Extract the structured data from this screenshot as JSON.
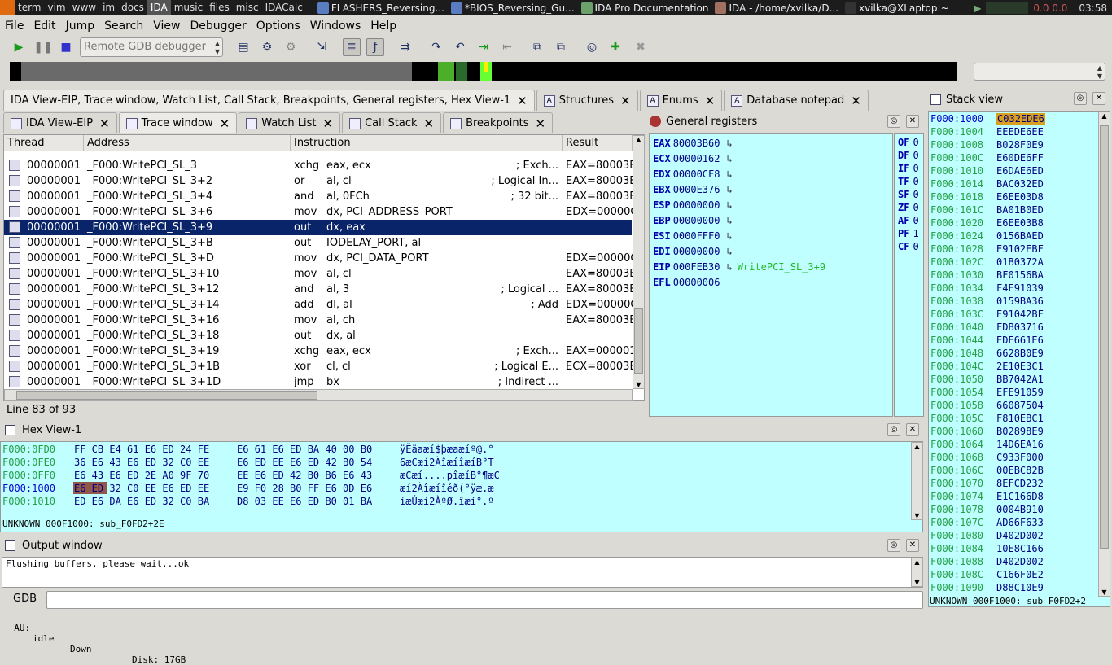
{
  "taskbar": {
    "tags": [
      "term",
      "vim",
      "www",
      "im",
      "docs",
      "IDA",
      "music",
      "files",
      "misc",
      "IDACalc"
    ],
    "active_tag": "IDA",
    "tasks": [
      {
        "label": "FLASHERS_Reversing..."
      },
      {
        "label": "*BIOS_Reversing_Gu..."
      },
      {
        "label": "IDA Pro Documentation"
      },
      {
        "label": "IDA - /home/xvilka/D..."
      },
      {
        "label": "xvilka@XLaptop:~"
      }
    ],
    "load": "0.0 0.0",
    "time": "03:58"
  },
  "menu": [
    "File",
    "Edit",
    "Jump",
    "Search",
    "View",
    "Debugger",
    "Options",
    "Windows",
    "Help"
  ],
  "toolbar": {
    "debugger_select": "Remote GDB debugger"
  },
  "tabs_top": [
    {
      "label": "IDA View-EIP, Trace window, Watch List, Call Stack, Breakpoints, General registers, Hex View-1"
    },
    {
      "label": "Structures"
    },
    {
      "label": "Enums"
    },
    {
      "label": "Database notepad"
    }
  ],
  "tabs_sub": [
    {
      "label": "IDA View-EIP"
    },
    {
      "label": "Trace window"
    },
    {
      "label": "Watch List"
    },
    {
      "label": "Call Stack"
    },
    {
      "label": "Breakpoints"
    }
  ],
  "trace": {
    "columns": [
      "Thread",
      "Address",
      "Instruction",
      "Result"
    ],
    "rows": [
      {
        "thread": "00000001",
        "addr": "_F000:WritePCI_SL_3",
        "mnem": "xchg",
        "ops": "eax, ecx",
        "cmt": "; Exch...",
        "res": "EAX=80003B"
      },
      {
        "thread": "00000001",
        "addr": "_F000:WritePCI_SL_3+2",
        "mnem": "or",
        "ops": "al, cl",
        "cmt": "; Logical In...",
        "res": "EAX=80003B"
      },
      {
        "thread": "00000001",
        "addr": "_F000:WritePCI_SL_3+4",
        "mnem": "and",
        "ops": "al, 0FCh",
        "cmt": "; 32 bit...",
        "res": "EAX=80003B"
      },
      {
        "thread": "00000001",
        "addr": "_F000:WritePCI_SL_3+6",
        "mnem": "mov",
        "ops": "dx, PCI_ADDRESS_PORT",
        "cmt": "",
        "res": "EDX=00000C"
      },
      {
        "thread": "00000001",
        "addr": "_F000:WritePCI_SL_3+9",
        "mnem": "out",
        "ops": "dx, eax",
        "cmt": "",
        "res": ""
      },
      {
        "thread": "00000001",
        "addr": "_F000:WritePCI_SL_3+B",
        "mnem": "out",
        "ops": "IODELAY_PORT, al",
        "cmt": "",
        "res": ""
      },
      {
        "thread": "00000001",
        "addr": "_F000:WritePCI_SL_3+D",
        "mnem": "mov",
        "ops": "dx, PCI_DATA_PORT",
        "cmt": "",
        "res": "EDX=00000C"
      },
      {
        "thread": "00000001",
        "addr": "_F000:WritePCI_SL_3+10",
        "mnem": "mov",
        "ops": "al, cl",
        "cmt": "",
        "res": "EAX=80003B"
      },
      {
        "thread": "00000001",
        "addr": "_F000:WritePCI_SL_3+12",
        "mnem": "and",
        "ops": "al, 3",
        "cmt": "; Logical ...",
        "res": "EAX=80003B"
      },
      {
        "thread": "00000001",
        "addr": "_F000:WritePCI_SL_3+14",
        "mnem": "add",
        "ops": "dl, al",
        "cmt": "; Add",
        "res": "EDX=00000C"
      },
      {
        "thread": "00000001",
        "addr": "_F000:WritePCI_SL_3+16",
        "mnem": "mov",
        "ops": "al, ch",
        "cmt": "",
        "res": "EAX=80003B"
      },
      {
        "thread": "00000001",
        "addr": "_F000:WritePCI_SL_3+18",
        "mnem": "out",
        "ops": "dx, al",
        "cmt": "",
        "res": ""
      },
      {
        "thread": "00000001",
        "addr": "_F000:WritePCI_SL_3+19",
        "mnem": "xchg",
        "ops": "eax, ecx",
        "cmt": "; Exch...",
        "res": "EAX=000001"
      },
      {
        "thread": "00000001",
        "addr": "_F000:WritePCI_SL_3+1B",
        "mnem": "xor",
        "ops": "cl, cl",
        "cmt": "; Logical E...",
        "res": "ECX=80003B"
      },
      {
        "thread": "00000001",
        "addr": "_F000:WritePCI_SL_3+1D",
        "mnem": "jmp",
        "ops": "bx",
        "cmt": "; Indirect ...",
        "res": ""
      }
    ],
    "status": "Line 83 of 93"
  },
  "registers": {
    "title": "General registers",
    "list": [
      {
        "name": "EAX",
        "value": "80003B60",
        "extra": ""
      },
      {
        "name": "ECX",
        "value": "00000162",
        "extra": ""
      },
      {
        "name": "EDX",
        "value": "00000CF8",
        "extra": ""
      },
      {
        "name": "EBX",
        "value": "0000E376",
        "extra": ""
      },
      {
        "name": "ESP",
        "value": "00000000",
        "extra": ""
      },
      {
        "name": "EBP",
        "value": "00000000",
        "extra": ""
      },
      {
        "name": "ESI",
        "value": "0000FFF0",
        "extra": ""
      },
      {
        "name": "EDI",
        "value": "00000000",
        "extra": ""
      },
      {
        "name": "EIP",
        "value": "000FEB30",
        "extra": "WritePCI_SL_3+9"
      },
      {
        "name": "EFL",
        "value": "00000006",
        "extra": ""
      }
    ],
    "flags": [
      {
        "name": "OF",
        "value": "0"
      },
      {
        "name": "DF",
        "value": "0"
      },
      {
        "name": "IF",
        "value": "0"
      },
      {
        "name": "TF",
        "value": "0"
      },
      {
        "name": "SF",
        "value": "0"
      },
      {
        "name": "ZF",
        "value": "0"
      },
      {
        "name": "AF",
        "value": "0"
      },
      {
        "name": "PF",
        "value": "1"
      },
      {
        "name": "CF",
        "value": "0"
      }
    ]
  },
  "stack": {
    "title": "Stack view",
    "rows": [
      {
        "a": "F000:1000",
        "v": "C032EDE6"
      },
      {
        "a": "F000:1004",
        "v": "EEEDE6EE"
      },
      {
        "a": "F000:1008",
        "v": "B028F0E9"
      },
      {
        "a": "F000:100C",
        "v": "E60DE6FF"
      },
      {
        "a": "F000:1010",
        "v": "E6DAE6ED"
      },
      {
        "a": "F000:1014",
        "v": "BAC032ED"
      },
      {
        "a": "F000:1018",
        "v": "E6EE03D8"
      },
      {
        "a": "F000:101C",
        "v": "BA01B0ED"
      },
      {
        "a": "F000:1020",
        "v": "E6EE03B8"
      },
      {
        "a": "F000:1024",
        "v": "0156BAED"
      },
      {
        "a": "F000:1028",
        "v": "E9102EBF"
      },
      {
        "a": "F000:102C",
        "v": "01B0372A"
      },
      {
        "a": "F000:1030",
        "v": "BF0156BA"
      },
      {
        "a": "F000:1034",
        "v": "F4E91039"
      },
      {
        "a": "F000:1038",
        "v": "0159BA36"
      },
      {
        "a": "F000:103C",
        "v": "E91042BF"
      },
      {
        "a": "F000:1040",
        "v": "FDB03716"
      },
      {
        "a": "F000:1044",
        "v": "EDE661E6"
      },
      {
        "a": "F000:1048",
        "v": "6628B0E9"
      },
      {
        "a": "F000:104C",
        "v": "2E10E3C1"
      },
      {
        "a": "F000:1050",
        "v": "BB7042A1"
      },
      {
        "a": "F000:1054",
        "v": "EFE91059"
      },
      {
        "a": "F000:1058",
        "v": "66087504"
      },
      {
        "a": "F000:105C",
        "v": "F810EBC1"
      },
      {
        "a": "F000:1060",
        "v": "B02898E9"
      },
      {
        "a": "F000:1064",
        "v": "14D6EA16"
      },
      {
        "a": "F000:1068",
        "v": "C933F000"
      },
      {
        "a": "F000:106C",
        "v": "00EBC82B"
      },
      {
        "a": "F000:1070",
        "v": "8EFCD232"
      },
      {
        "a": "F000:1074",
        "v": "E1C166D8"
      },
      {
        "a": "F000:1078",
        "v": "0004B910"
      },
      {
        "a": "F000:107C",
        "v": "AD66F633"
      },
      {
        "a": "F000:1080",
        "v": "D402D002"
      },
      {
        "a": "F000:1084",
        "v": "10E8C166"
      },
      {
        "a": "F000:1088",
        "v": "D402D002"
      },
      {
        "a": "F000:108C",
        "v": "C166F0E2"
      },
      {
        "a": "F000:1090",
        "v": "D88C10E9"
      }
    ],
    "status": "UNKNOWN 000F1000: sub_F0FD2+2"
  },
  "hexview": {
    "title": "Hex View-1",
    "rows": [
      {
        "a": "F000:0FD0",
        "b1": "FF CB E4 61 E6 ED 24 FE",
        "b2": "E6 61 E6 ED BA 40 00 B0",
        "t": "ÿËäaæí$þæaæíº@.°"
      },
      {
        "a": "F000:0FE0",
        "b1": "36 E6 43 E6 ED 32 C0 EE",
        "b2": "E6 ED EE E6 ED 42 B0 54",
        "t": "6æCæí2ÀîæíîæíB°T"
      },
      {
        "a": "F000:0FF0",
        "b1": "E6 43 E6 ED 2E A0 9F 70",
        "b2": "EE E6 ED 42 B0 B6 E6 43",
        "t": "æCæí....pîæíB°¶æC"
      },
      {
        "a": "F000:1000",
        "b1": "E6 ED 32 C0 EE E6 ED EE",
        "b2": "E9 F0 28 B0 FF E6 0D E6",
        "t": "æí2Àîæíîéð(°ÿæ.æ"
      },
      {
        "a": "F000:1010",
        "b1": "ED E6 DA E6 ED 32 C0 BA",
        "b2": "D8 03 EE E6 ED B0 01 BA",
        "t": "íæÚæí2ÀºØ.îæí°.º"
      }
    ],
    "status": "UNKNOWN 000F1000: sub_F0FD2+2E"
  },
  "output": {
    "title": "Output window",
    "text": "Flushing buffers, please wait...ok"
  },
  "command": {
    "label": "GDB",
    "value": ""
  },
  "statusbar": {
    "au": "AU:",
    "state": "idle",
    "dir": "Down",
    "disk": "Disk: 17GB"
  }
}
